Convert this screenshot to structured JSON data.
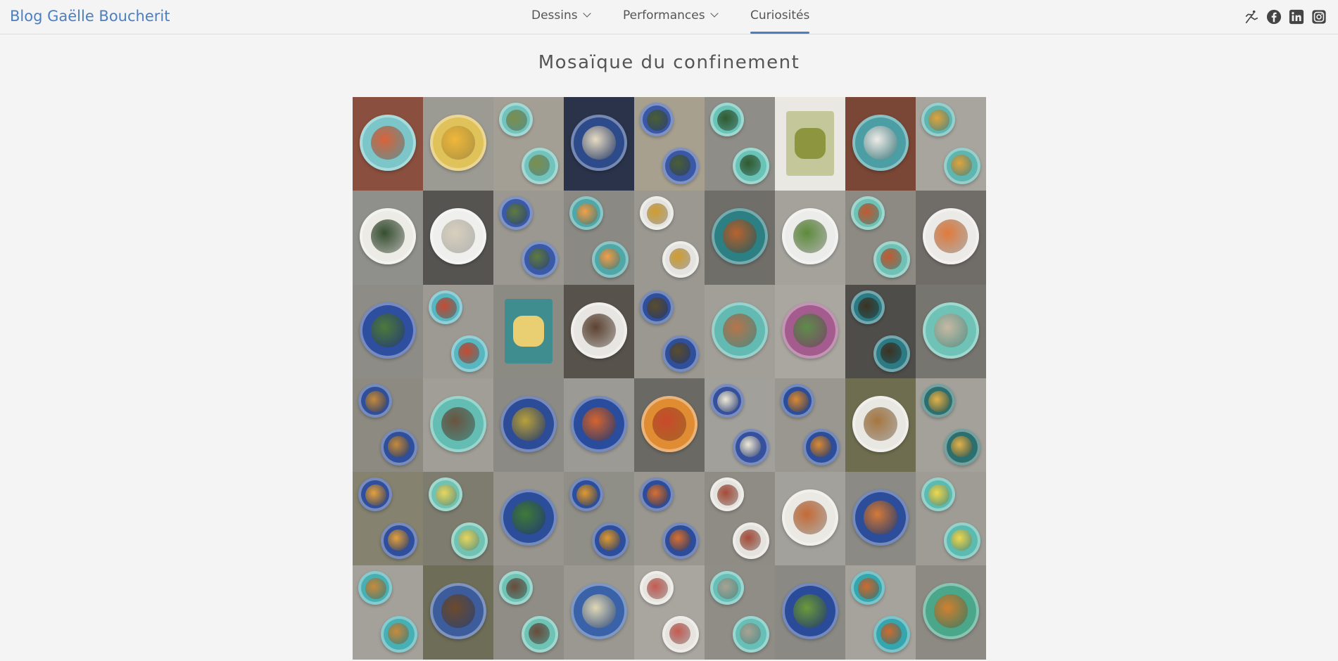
{
  "header": {
    "brand": "Blog Gaëlle Boucherit",
    "nav": [
      {
        "label": "Dessins",
        "dropdown": true
      },
      {
        "label": "Performances",
        "dropdown": true
      },
      {
        "label": "Curiosités",
        "dropdown": false,
        "active": true
      }
    ],
    "social_icons": [
      "dancer-icon",
      "facebook-icon",
      "linkedin-icon",
      "instagram-icon"
    ],
    "accent_color": "#4a7fc1"
  },
  "main": {
    "title": "Mosaïque du confinement",
    "mosaic": {
      "columns": 9,
      "rows": 6,
      "content": "photos of meal plates viewed from above",
      "tiles": [
        {
          "bg": "#8a4f3e",
          "layout": "big",
          "plate": "#7cc6c9",
          "food": "#d9623a"
        },
        {
          "bg": "#9b9a93",
          "layout": "big",
          "plate": "#e0c25a",
          "food": "#f0b73a"
        },
        {
          "bg": "#a49f94",
          "layout": "two",
          "plate": "#73c3bd",
          "food": "#7c8e4c"
        },
        {
          "bg": "#2a3349",
          "layout": "big",
          "plate": "#2d4a8a",
          "food": "#e8dcc2"
        },
        {
          "bg": "#a7a08f",
          "layout": "two",
          "plate": "#3a58a5",
          "food": "#4b5e32"
        },
        {
          "bg": "#8f8d87",
          "layout": "two",
          "plate": "#6ac3b7",
          "food": "#305a2e"
        },
        {
          "bg": "#e9e8e3",
          "layout": "square",
          "plate": "#c4c79a",
          "food": "#8d963e"
        },
        {
          "bg": "#7a4635",
          "layout": "big",
          "plate": "#4a9ea4",
          "food": "#efece8"
        },
        {
          "bg": "#a7a59e",
          "layout": "two",
          "plate": "#5fb5b0",
          "food": "#e0a43d"
        },
        {
          "bg": "#8f8f8b",
          "layout": "big",
          "plate": "#ecebe6",
          "food": "#364f30"
        },
        {
          "bg": "#565450",
          "layout": "big",
          "plate": "#efefed",
          "food": "#d7d0bd"
        },
        {
          "bg": "#9a9890",
          "layout": "two",
          "plate": "#3a5aa8",
          "food": "#5f7b41"
        },
        {
          "bg": "#8a8984",
          "layout": "two",
          "plate": "#4fa7a8",
          "food": "#f1a04a"
        },
        {
          "bg": "#9a9891",
          "layout": "two",
          "plate": "#e4e3df",
          "food": "#cf9c2e"
        },
        {
          "bg": "#706e69",
          "layout": "big",
          "plate": "#2c7f83",
          "food": "#b8622e"
        },
        {
          "bg": "#a4a29b",
          "layout": "big",
          "plate": "#ececea",
          "food": "#5d8b3a"
        },
        {
          "bg": "#8c8a83",
          "layout": "two",
          "plate": "#6fc0b5",
          "food": "#c25a2f"
        },
        {
          "bg": "#706d68",
          "layout": "big",
          "plate": "#ebeae6",
          "food": "#e07a3c"
        },
        {
          "bg": "#8e8c86",
          "layout": "big",
          "plate": "#2e4ea0",
          "food": "#4d7a3a"
        },
        {
          "bg": "#9c9a93",
          "layout": "two",
          "plate": "#58b6c0",
          "food": "#c74a32"
        },
        {
          "bg": "#8b8a83",
          "layout": "square",
          "plate": "#3f8d8f",
          "food": "#e9cf72"
        },
        {
          "bg": "#57524b",
          "layout": "big",
          "plate": "#e8e6e2",
          "food": "#5d4230"
        },
        {
          "bg": "#9a9890",
          "layout": "two",
          "plate": "#2f4f9c",
          "food": "#5b4d2c"
        },
        {
          "bg": "#a19f97",
          "layout": "big",
          "plate": "#63bab2",
          "food": "#b7744a"
        },
        {
          "bg": "#aaa7a0",
          "layout": "big",
          "plate": "#a45c8e",
          "food": "#5e8c4a"
        },
        {
          "bg": "#4f4d49",
          "layout": "two",
          "plate": "#2c7a83",
          "food": "#3e3222"
        },
        {
          "bg": "#77756f",
          "layout": "big",
          "plate": "#6ec2b6",
          "food": "#c7b9a3"
        },
        {
          "bg": "#8d8a82",
          "layout": "two",
          "plate": "#2f4f9a",
          "food": "#c58a3c"
        },
        {
          "bg": "#a09e96",
          "layout": "big",
          "plate": "#63bdb3",
          "food": "#6a5440"
        },
        {
          "bg": "#8c8a84",
          "layout": "big",
          "plate": "#2d4c98",
          "food": "#b8a13a"
        },
        {
          "bg": "#9c9a94",
          "layout": "big",
          "plate": "#2a4c9c",
          "food": "#d5642f"
        },
        {
          "bg": "#6b6963",
          "layout": "big",
          "plate": "#e08c33",
          "food": "#c94a2a"
        },
        {
          "bg": "#a2a09a",
          "layout": "two",
          "plate": "#35509c",
          "food": "#efe9d6"
        },
        {
          "bg": "#99978f",
          "layout": "two",
          "plate": "#2c4d9a",
          "food": "#d98a33"
        },
        {
          "bg": "#6e6d4f",
          "layout": "big",
          "plate": "#e9e7e2",
          "food": "#a6763f"
        },
        {
          "bg": "#a3a19a",
          "layout": "two",
          "plate": "#2c6f6f",
          "food": "#e2b24a"
        },
        {
          "bg": "#85826f",
          "layout": "two",
          "plate": "#2f4e9c",
          "food": "#e4a13c"
        },
        {
          "bg": "#7d7c6f",
          "layout": "two",
          "plate": "#70c3b3",
          "food": "#e8d65d"
        },
        {
          "bg": "#97958d",
          "layout": "big",
          "plate": "#2c4d9a",
          "food": "#3f7a38"
        },
        {
          "bg": "#8f8e87",
          "layout": "two",
          "plate": "#2c4e9c",
          "food": "#e09a2f"
        },
        {
          "bg": "#999790",
          "layout": "two",
          "plate": "#2d4c9a",
          "food": "#d77032"
        },
        {
          "bg": "#8e8c85",
          "layout": "two",
          "plate": "#e5e3dd",
          "food": "#a84a37"
        },
        {
          "bg": "#a3a19b",
          "layout": "big",
          "plate": "#ebe9e4",
          "food": "#c46a35"
        },
        {
          "bg": "#8b8a84",
          "layout": "big",
          "plate": "#2c4d9a",
          "food": "#d57a37"
        },
        {
          "bg": "#9e9c95",
          "layout": "two",
          "plate": "#5cbbb1",
          "food": "#f0d84c"
        },
        {
          "bg": "#a3a19a",
          "layout": "two",
          "plate": "#47b0b5",
          "food": "#c98a3a"
        },
        {
          "bg": "#6e6d58",
          "layout": "big",
          "plate": "#3c5c9c",
          "food": "#6e4a2c"
        },
        {
          "bg": "#8f8d86",
          "layout": "two",
          "plate": "#6ec3b5",
          "food": "#6a4b3a"
        },
        {
          "bg": "#9a9891",
          "layout": "big",
          "plate": "#3a62a8",
          "food": "#e0d8b6"
        },
        {
          "bg": "#a8a69f",
          "layout": "two",
          "plate": "#e7e4df",
          "food": "#c45a52"
        },
        {
          "bg": "#8f8d86",
          "layout": "two",
          "plate": "#66c0b8",
          "food": "#a9a293"
        },
        {
          "bg": "#8b8983",
          "layout": "big",
          "plate": "#2a4a9a",
          "food": "#6c9a3a"
        },
        {
          "bg": "#a5a39c",
          "layout": "two",
          "plate": "#35a6ae",
          "food": "#cf6a2f"
        },
        {
          "bg": "#8c8a83",
          "layout": "big",
          "plate": "#4aa78a",
          "food": "#d1802f"
        }
      ]
    }
  }
}
